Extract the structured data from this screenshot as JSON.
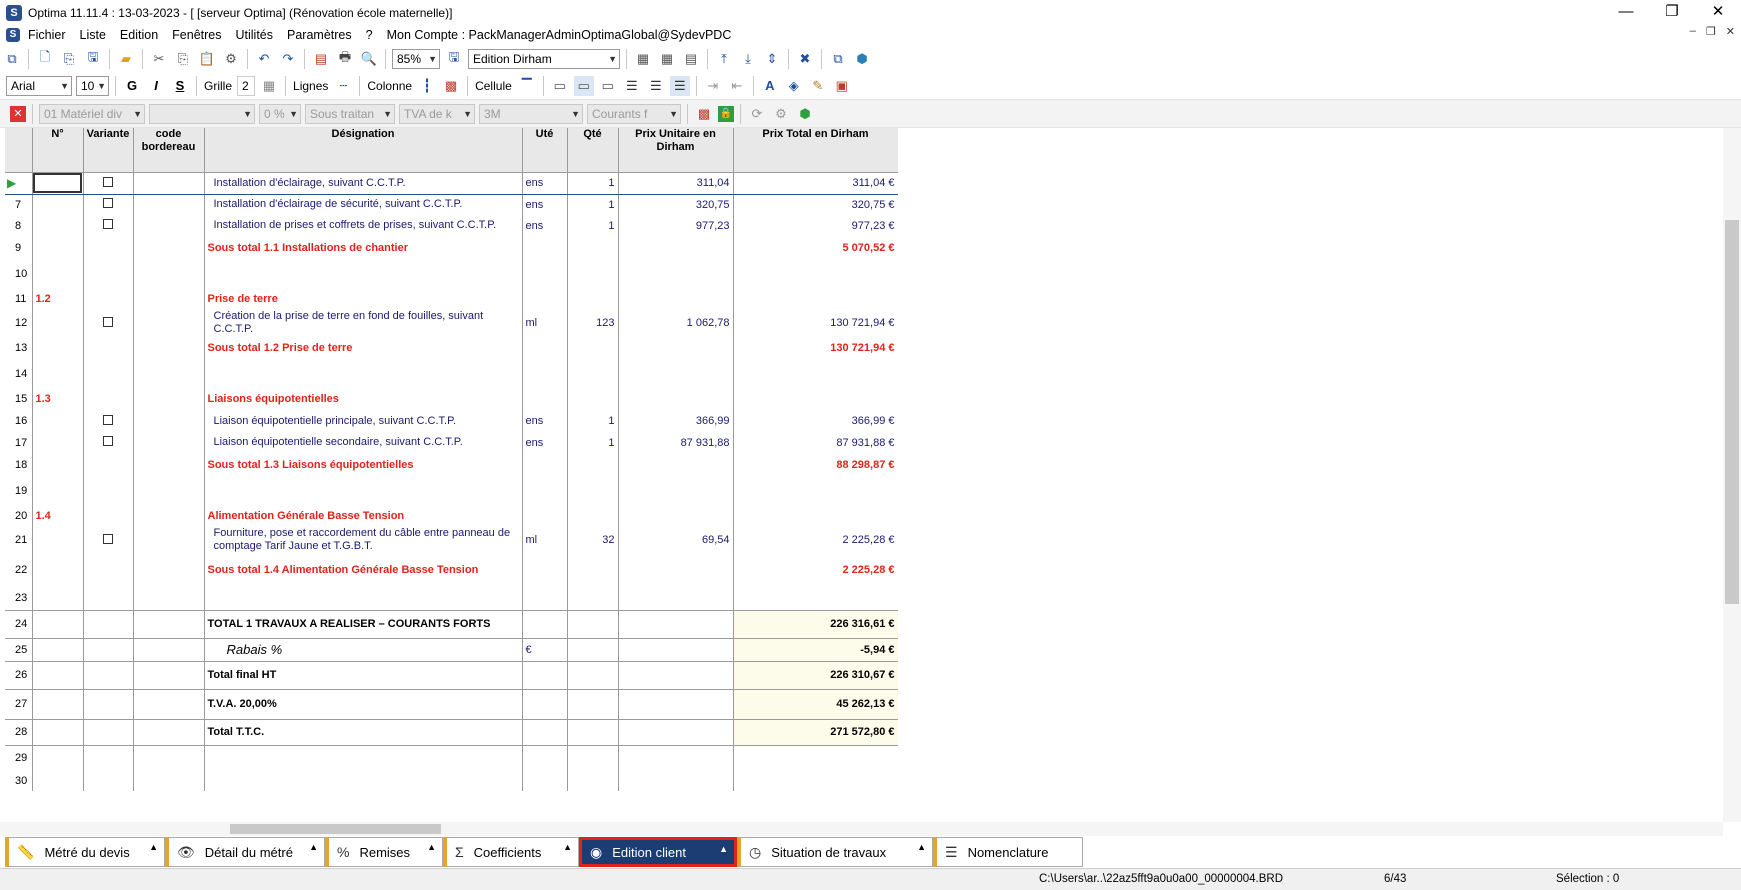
{
  "window": {
    "title": "Optima 11.11.4 : 13-03-2023 - [ [serveur Optima] (Rénovation école maternelle)]",
    "minimize": "—",
    "restore": "❐",
    "close": "✕"
  },
  "menu": [
    "Fichier",
    "Liste",
    "Edition",
    "Fenêtres",
    "Utilités",
    "Paramètres",
    "?",
    "Mon Compte : PackManagerAdminOptimaGlobal@SydevPDC"
  ],
  "toolbar1": {
    "zoom": "85%",
    "edition_combo": "Edition Dirham"
  },
  "toolbar2": {
    "font": "Arial",
    "size": "10",
    "bold": "G",
    "italic": "I",
    "underline": "S",
    "grille_label": "Grille",
    "grille_value": "2",
    "lignes_label": "Lignes",
    "colonne_label": "Colonne",
    "cellule_label": "Cellule"
  },
  "toolbar3": {
    "materiel": "01 Matériel div",
    "blank_combo": "",
    "pct": "0 %",
    "sous_traitant": "Sous traitan",
    "tva": "TVA de k",
    "three_m": "3M",
    "courants": "Courants f"
  },
  "columns": {
    "num": "N°",
    "variante": "Variante",
    "code": "code bordereau",
    "designation": "Désignation",
    "ute": "Uté",
    "qte": "Qté",
    "pu": "Prix Unitaire en Dirham",
    "pt": "Prix Total en Dirham"
  },
  "rows": [
    {
      "rn": "",
      "code": "",
      "designation": "Installation d'éclairage, suivant C.C.T.P.",
      "ute": "ens",
      "qte": "1",
      "pu": "311,04",
      "pt": "311,04 €"
    },
    {
      "rn": "7",
      "designation": "Installation d'éclairage de sécurité, suivant C.C.T.P.",
      "ute": "ens",
      "qte": "1",
      "pu": "320,75",
      "pt": "320,75 €"
    },
    {
      "rn": "8",
      "designation": "Installation de prises et coffrets de prises, suivant C.C.T.P.",
      "ute": "ens",
      "qte": "1",
      "pu": "977,23",
      "pt": "977,23 €"
    },
    {
      "rn": "9",
      "subtotal": "Sous total 1.1 Installations de chantier",
      "pt": "5 070,52 €"
    },
    {
      "rn": "10"
    },
    {
      "rn": "11",
      "num": "1.2",
      "section": "Prise de terre"
    },
    {
      "rn": "12",
      "designation": "Création de la prise de terre en fond de fouilles, suivant C.C.T.P.",
      "ute": "ml",
      "qte": "123",
      "pu": "1 062,78",
      "pt": "130 721,94 €"
    },
    {
      "rn": "13",
      "subtotal": "Sous total 1.2 Prise de terre",
      "pt": "130 721,94 €"
    },
    {
      "rn": "14"
    },
    {
      "rn": "15",
      "num": "1.3",
      "section": "Liaisons équipotentielles"
    },
    {
      "rn": "16",
      "designation": "Liaison équipotentielle principale, suivant C.C.T.P.",
      "ute": "ens",
      "qte": "1",
      "pu": "366,99",
      "pt": "366,99 €"
    },
    {
      "rn": "17",
      "designation": "Liaison équipotentielle secondaire, suivant C.C.T.P.",
      "ute": "ens",
      "qte": "1",
      "pu": "87 931,88",
      "pt": "87 931,88 €"
    },
    {
      "rn": "18",
      "subtotal": "Sous total 1.3 Liaisons équipotentielles",
      "pt": "88 298,87 €"
    },
    {
      "rn": "19"
    },
    {
      "rn": "20",
      "num": "1.4",
      "section": "Alimentation Générale Basse Tension"
    },
    {
      "rn": "21",
      "designation": "Fourniture, pose et raccordement du câble entre panneau de comptage Tarif Jaune et T.G.B.T.",
      "ute": "ml",
      "qte": "32",
      "pu": "69,54",
      "pt": "2 225,28 €"
    },
    {
      "rn": "22",
      "subtotal": "Sous total 1.4 Alimentation Générale Basse Tension",
      "pt": "2 225,28 €"
    },
    {
      "rn": "23"
    },
    {
      "rn": "24",
      "total": "TOTAL 1 TRAVAUX A REALISER – COURANTS FORTS",
      "pt": "226 316,61 €"
    },
    {
      "rn": "25",
      "rabais": "Rabais %",
      "ute": "€",
      "pt": "-5,94 €"
    },
    {
      "rn": "26",
      "total": "Total final HT",
      "pt": "226 310,67 €"
    },
    {
      "rn": "27",
      "total": "T.V.A. 20,00%",
      "pt": "45 262,13 €"
    },
    {
      "rn": "28",
      "total": "Total  T.T.C.",
      "pt": "271 572,80 €"
    },
    {
      "rn": "29"
    },
    {
      "rn": "30"
    }
  ],
  "tabs": [
    {
      "label": "Métré du devis",
      "icon": "ruler-icon"
    },
    {
      "label": "Détail du métré",
      "icon": "eye-icon"
    },
    {
      "label": "Remises",
      "icon": "percent-icon"
    },
    {
      "label": "Coefficients",
      "icon": "sigma-icon"
    },
    {
      "label": "Edition client",
      "icon": "user-icon"
    },
    {
      "label": "Situation de travaux",
      "icon": "clock-icon"
    },
    {
      "label": "Nomenclature",
      "icon": "list-icon"
    }
  ],
  "status": {
    "path": "C:\\Users\\ar..\\22az5fft9a0u0a00_00000004.BRD",
    "page": "6/43",
    "selection": "Sélection : 0"
  },
  "colors": {
    "red": "#e0231b",
    "navy": "#1a1a6e",
    "active_tab": "#1c3d74"
  }
}
